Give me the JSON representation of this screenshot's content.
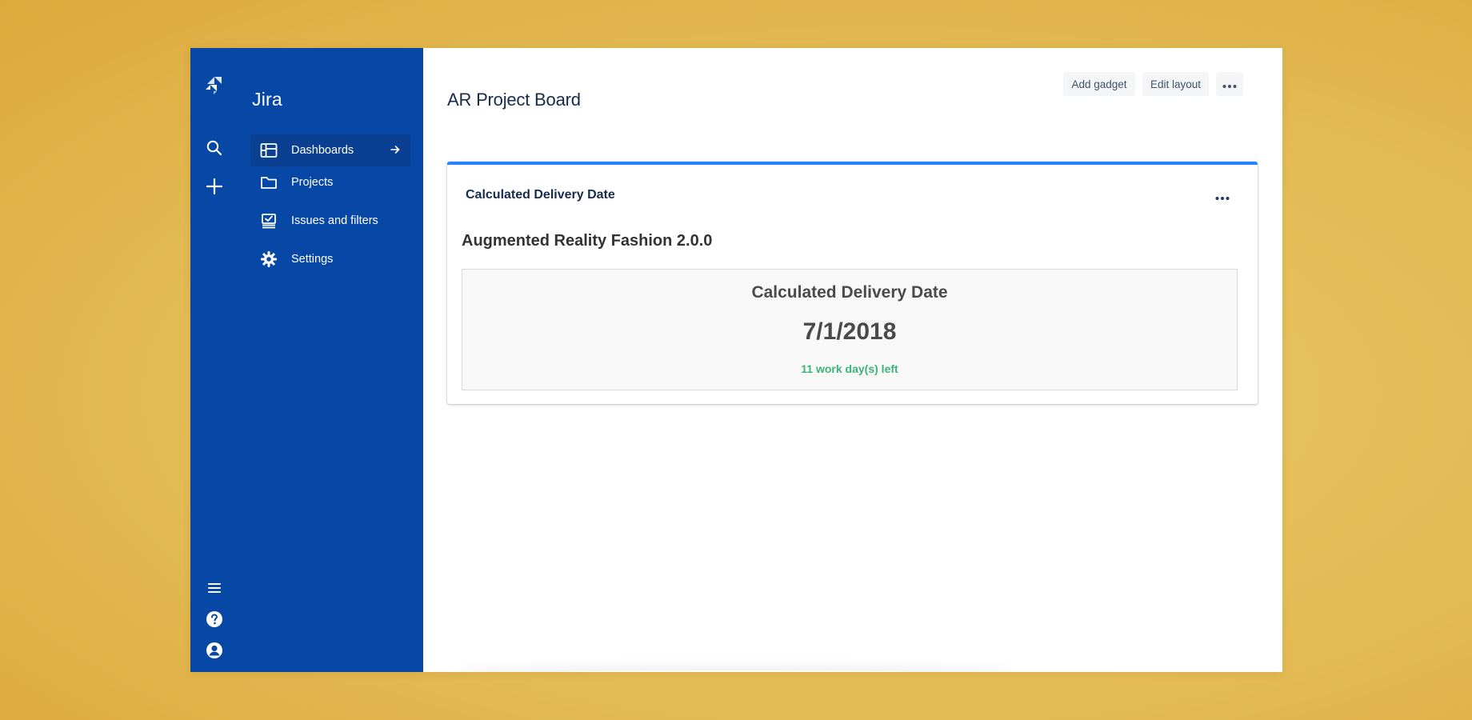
{
  "app": {
    "product_name": "Jira"
  },
  "global_nav": {
    "icons": [
      "jira-logo-icon",
      "search-icon",
      "create-icon",
      "menu-icon",
      "help-icon",
      "profile-icon"
    ]
  },
  "sidebar": {
    "items": [
      {
        "label": "Dashboards",
        "icon": "dashboard-icon",
        "active": true
      },
      {
        "label": "Projects",
        "icon": "folder-icon",
        "active": false
      },
      {
        "label": "Issues and filters",
        "icon": "issues-icon",
        "active": false
      },
      {
        "label": "Settings",
        "icon": "gear-icon",
        "active": false
      }
    ]
  },
  "header": {
    "title": "AR Project Board",
    "add_gadget_label": "Add gadget",
    "edit_layout_label": "Edit layout"
  },
  "gadget": {
    "title": "Calculated Delivery Date",
    "version_name": "Augmented Reality Fashion 2.0.0",
    "result_heading": "Calculated Delivery Date",
    "delivery_date": "7/1/2018",
    "status_text": "11 work day(s) left"
  },
  "colors": {
    "nav_background": "#0747a6",
    "active_item": "#0a3f91",
    "gadget_accent": "#2684ff",
    "status_green": "#3db27a",
    "backdrop": "#e4bb55"
  }
}
